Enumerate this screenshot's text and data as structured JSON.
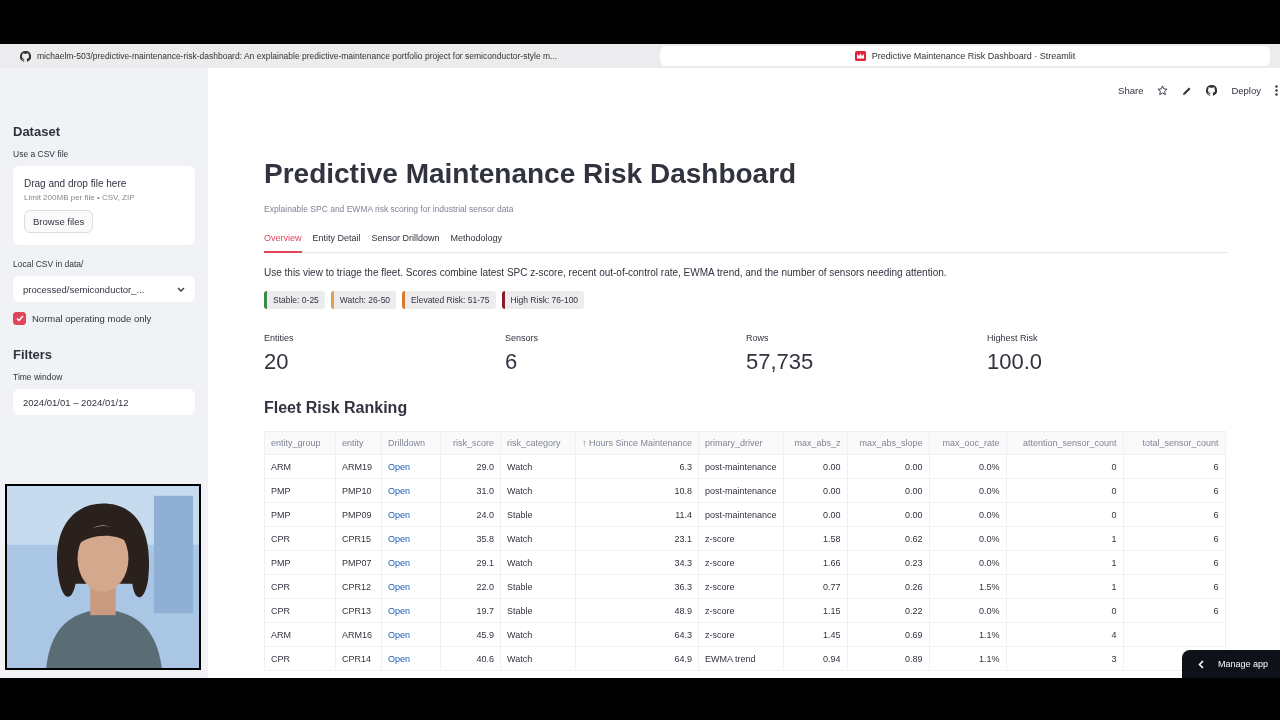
{
  "browser_tabs": [
    {
      "label": "michaelm-503/predictive-maintenance-risk-dashboard: An explainable predictive-maintenance portfolio project for semiconductor-style m...",
      "kind": "github",
      "selected": false
    },
    {
      "label": "Predictive Maintenance Risk Dashboard · Streamlit",
      "kind": "streamlit",
      "selected": true
    }
  ],
  "toolbar": {
    "share": "Share",
    "deploy": "Deploy"
  },
  "sidebar": {
    "dataset_heading": "Dataset",
    "upload_label": "Use a CSV file",
    "upload_title": "Drag and drop file here",
    "upload_hint": "Limit 200MB per file • CSV, ZIP",
    "browse_button": "Browse files",
    "local_label": "Local CSV in data/",
    "local_value": "processed/semiconductor_...",
    "checkbox": {
      "label": "Normal operating mode only",
      "checked": true
    },
    "filters_heading": "Filters",
    "time_label": "Time window",
    "time_value": "2024/01/01 – 2024/01/12"
  },
  "title": "Predictive Maintenance Risk Dashboard",
  "subtitle": "Explainable SPC and EWMA risk scoring for industrial sensor data",
  "tabs": [
    {
      "label": "Overview",
      "selected": true
    },
    {
      "label": "Entity Detail",
      "selected": false
    },
    {
      "label": "Sensor Drilldown",
      "selected": false
    },
    {
      "label": "Methodology",
      "selected": false
    }
  ],
  "intro": "Use this view to triage the fleet. Scores combine latest SPC z-score, recent out-of-control rate, EWMA trend, and the number of sensors needing attention.",
  "legend": [
    {
      "label": "Stable: 0-25",
      "color": "#3a8a4a"
    },
    {
      "label": "Watch: 26-50",
      "color": "#e0a050"
    },
    {
      "label": "Elevated Risk: 51-75",
      "color": "#d9772b"
    },
    {
      "label": "High Risk: 76-100",
      "color": "#8b1a2b"
    }
  ],
  "metrics": [
    {
      "label": "Entities",
      "value": "20"
    },
    {
      "label": "Sensors",
      "value": "6"
    },
    {
      "label": "Rows",
      "value": "57,735"
    },
    {
      "label": "Highest Risk",
      "value": "100.0"
    }
  ],
  "table_heading": "Fleet Risk Ranking",
  "table": {
    "columns": [
      {
        "label": "entity_group",
        "kind": "text"
      },
      {
        "label": "entity",
        "kind": "text"
      },
      {
        "label": "Drilldown",
        "kind": "link"
      },
      {
        "label": "risk_score",
        "kind": "number"
      },
      {
        "label": "risk_category",
        "kind": "text"
      },
      {
        "label": "↑ Hours Since Maintenance",
        "kind": "number"
      },
      {
        "label": "primary_driver",
        "kind": "text"
      },
      {
        "label": "max_abs_z",
        "kind": "number"
      },
      {
        "label": "max_abs_slope",
        "kind": "number"
      },
      {
        "label": "max_ooc_rate",
        "kind": "number"
      },
      {
        "label": "attention_sensor_count",
        "kind": "number"
      },
      {
        "label": "total_sensor_count",
        "kind": "number"
      }
    ],
    "rows": [
      [
        "ARM",
        "ARM19",
        "Open",
        "29.0",
        "Watch",
        "6.3",
        "post-maintenance",
        "0.00",
        "0.00",
        "0.0%",
        "0",
        "6"
      ],
      [
        "PMP",
        "PMP10",
        "Open",
        "31.0",
        "Watch",
        "10.8",
        "post-maintenance",
        "0.00",
        "0.00",
        "0.0%",
        "0",
        "6"
      ],
      [
        "PMP",
        "PMP09",
        "Open",
        "24.0",
        "Stable",
        "11.4",
        "post-maintenance",
        "0.00",
        "0.00",
        "0.0%",
        "0",
        "6"
      ],
      [
        "CPR",
        "CPR15",
        "Open",
        "35.8",
        "Watch",
        "23.1",
        "z-score",
        "1.58",
        "0.62",
        "0.0%",
        "1",
        "6"
      ],
      [
        "PMP",
        "PMP07",
        "Open",
        "29.1",
        "Watch",
        "34.3",
        "z-score",
        "1.66",
        "0.23",
        "0.0%",
        "1",
        "6"
      ],
      [
        "CPR",
        "CPR12",
        "Open",
        "22.0",
        "Stable",
        "36.3",
        "z-score",
        "0.77",
        "0.26",
        "1.5%",
        "1",
        "6"
      ],
      [
        "CPR",
        "CPR13",
        "Open",
        "19.7",
        "Stable",
        "48.9",
        "z-score",
        "1.15",
        "0.22",
        "0.0%",
        "0",
        "6"
      ],
      [
        "ARM",
        "ARM16",
        "Open",
        "45.9",
        "Watch",
        "64.3",
        "z-score",
        "1.45",
        "0.69",
        "1.1%",
        "4"
      ],
      [
        "CPR",
        "CPR14",
        "Open",
        "40.6",
        "Watch",
        "64.9",
        "EWMA trend",
        "0.94",
        "0.89",
        "1.1%",
        "3"
      ]
    ]
  },
  "manage_app": "Manage app"
}
